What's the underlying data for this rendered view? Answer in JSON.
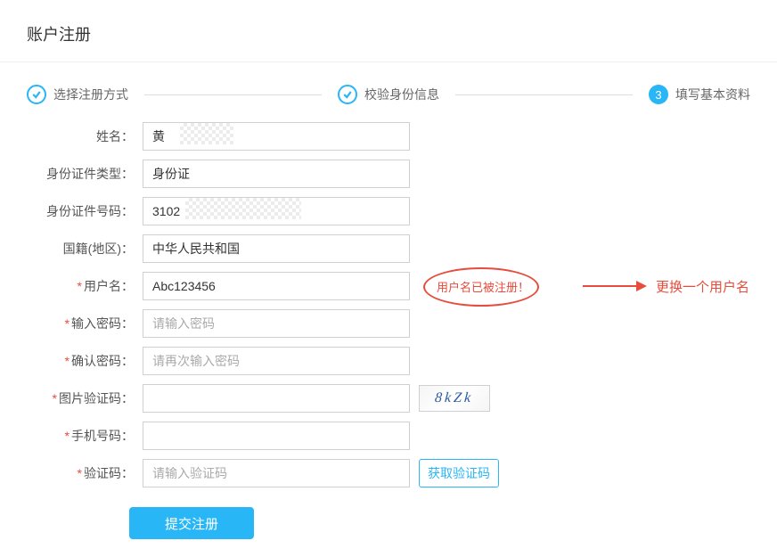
{
  "page_title": "账户注册",
  "steps": {
    "s1": "选择注册方式",
    "s2": "校验身份信息",
    "s3_num": "3",
    "s3": "填写基本资料"
  },
  "labels": {
    "name": "姓名：",
    "id_type": "身份证件类型：",
    "id_no": "身份证件号码：",
    "nationality": "国籍(地区)：",
    "username": "用户名：",
    "password": "输入密码：",
    "confirm": "确认密码：",
    "img_captcha": "图片验证码：",
    "phone": "手机号码：",
    "sms_code": "验证码："
  },
  "values": {
    "name": "黄",
    "id_type": "身份证",
    "id_no": "3102",
    "nationality": "中华人民共和国",
    "username": "Abc123456"
  },
  "placeholders": {
    "password": "请输入密码",
    "confirm": "请再次输入密码",
    "sms_code": "请输入验证码"
  },
  "captcha": "8kZk",
  "error_msg": "用户名已被注册！",
  "annotation": "更换一个用户名",
  "buttons": {
    "get_code": "获取验证码",
    "submit": "提交注册"
  }
}
